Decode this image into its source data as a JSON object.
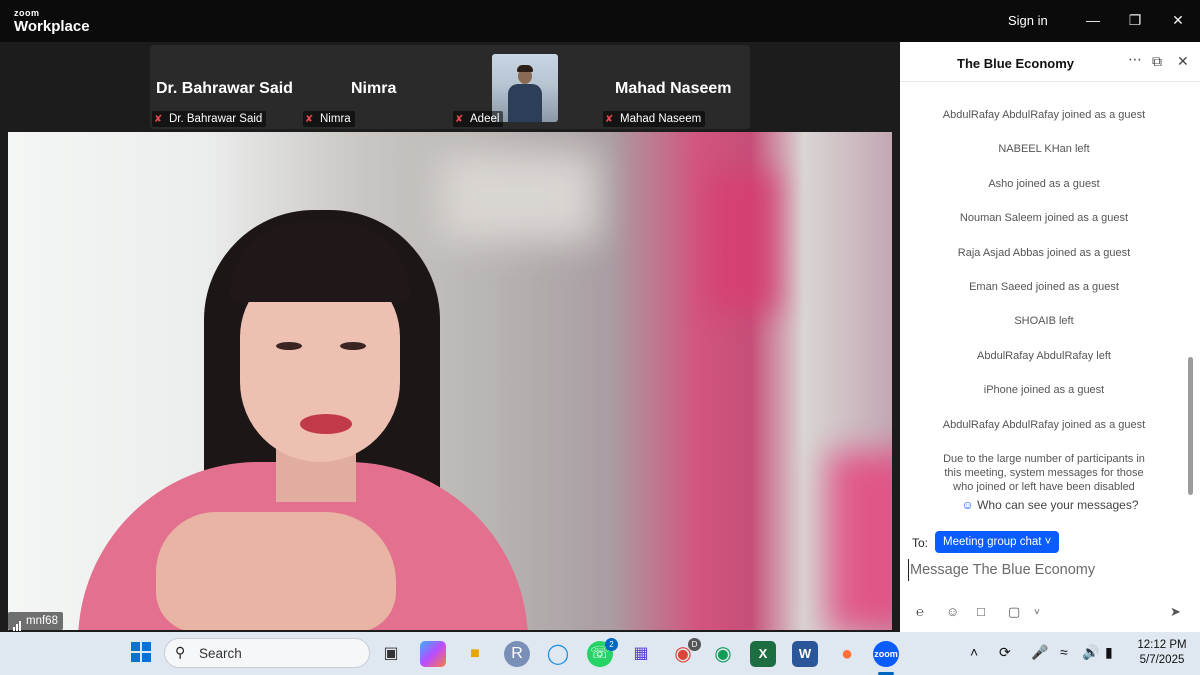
{
  "app": {
    "logo_top": "zoom",
    "logo_bottom": "Workplace",
    "sign_in": "Sign in"
  },
  "strip": {
    "tiles": [
      {
        "name": "Dr. Bahrawar Said",
        "label": "Dr. Bahrawar Said"
      },
      {
        "name": "Nimra",
        "label": "Nimra"
      },
      {
        "name": "",
        "label": "Adeel"
      },
      {
        "name": "Mahad Naseem",
        "label": "Mahad Naseem"
      }
    ]
  },
  "main_video": {
    "label": "mnf68"
  },
  "chat": {
    "title": "The Blue Economy",
    "messages": [
      "AbdulRafay AbdulRafay joined as a guest",
      "NABEEL KHan left",
      "Asho joined as a guest",
      "Nouman Saleem joined as a guest",
      "Raja Asjad Abbas joined as a guest",
      "Eman Saeed joined as a guest",
      "SHOAIB left",
      "AbdulRafay AbdulRafay left",
      "iPhone joined as a guest",
      "AbdulRafay AbdulRafay joined as a guest",
      "Due to the large number of participants in this meeting, system messages for those who joined or left have been disabled"
    ],
    "who_can_see": "Who can see your messages?",
    "to_label": "To:",
    "recipient": "Meeting group chat",
    "input_placeholder": "Message The Blue Economy"
  },
  "taskbar": {
    "search_label": "Search",
    "whatsapp_badge": "2",
    "chrome_badge": "D",
    "time": "12:12 PM",
    "date": "5/7/2025"
  }
}
